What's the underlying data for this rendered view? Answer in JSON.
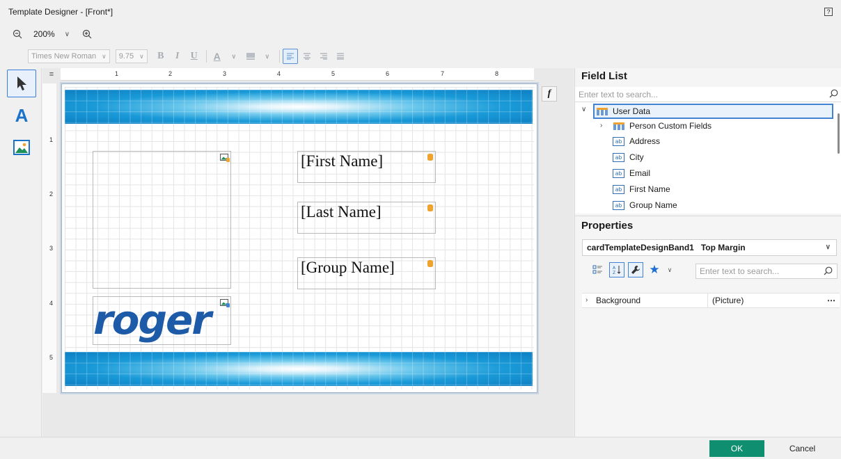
{
  "window": {
    "title": "Template Designer - [Front*]"
  },
  "zoom": {
    "value": "200%"
  },
  "format": {
    "font_family": "Times New Roman",
    "font_size": "9.75"
  },
  "ruler": {
    "h_numbers": [
      "1",
      "2",
      "3",
      "4",
      "5",
      "6",
      "7",
      "8"
    ],
    "v_numbers": [
      "1",
      "2",
      "3",
      "4",
      "5"
    ]
  },
  "canvas": {
    "fields": [
      "[First Name]",
      "[Last Name]",
      "[Group Name]"
    ],
    "logo_text": "roger"
  },
  "field_list": {
    "title": "Field List",
    "search_placeholder": "Enter text to search...",
    "root": "User Data",
    "items": [
      "Person Custom Fields",
      "Address",
      "City",
      "Email",
      "First Name",
      "Group Name"
    ]
  },
  "properties": {
    "title": "Properties",
    "object_name": "cardTemplateDesignBand1",
    "object_type": "Top Margin",
    "search_placeholder": "Enter text to search...",
    "rows": [
      {
        "name": "Background",
        "value": "(Picture)"
      }
    ]
  },
  "footer": {
    "ok": "OK",
    "cancel": "Cancel"
  },
  "colors": {
    "ok_button": "#0f8f6f",
    "accent": "#3f82d6",
    "band_blue": "#1a9ad8"
  }
}
